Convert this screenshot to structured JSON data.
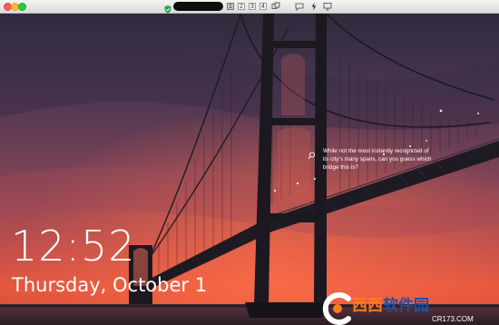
{
  "topbar": {
    "desktops": [
      "1",
      "2",
      "3",
      "4"
    ],
    "icons": [
      "shield-icon",
      "window-switch-icon",
      "chat-icon",
      "bolt-icon",
      "monitor-icon"
    ]
  },
  "lockscreen": {
    "time": "12:52",
    "date": "Thursday, October 1",
    "spotlight_text": "While not the most instantly recognized of its city's many spans, can you guess which bridge this is?"
  },
  "watermark": {
    "brand_chars_orange": "西西",
    "brand_chars_blue": "软件园",
    "url": "CR173.COM"
  },
  "colors": {
    "accent_orange": "#ff7a1a",
    "accent_blue": "#1d4fa6",
    "sky_top": "#2e2a3c",
    "sky_glow": "#ef5540"
  }
}
